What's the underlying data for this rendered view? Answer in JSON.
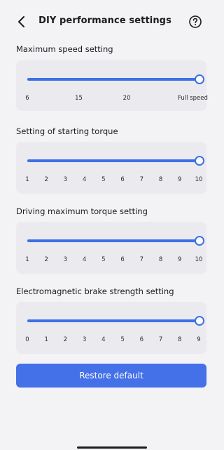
{
  "header": {
    "title": "DIY performance settings",
    "back_icon": "chevron-left-icon",
    "help_icon": "question-circle-icon"
  },
  "settings": [
    {
      "id": "max-speed",
      "label": "Maximum speed setting",
      "ticks": [
        "6",
        "15",
        "20",
        "Full speed"
      ],
      "value": "Full speed",
      "fraction": 1.0
    },
    {
      "id": "starting-torque",
      "label": "Setting of starting torque",
      "ticks": [
        "1",
        "2",
        "3",
        "4",
        "5",
        "6",
        "7",
        "8",
        "9",
        "10"
      ],
      "value": "10",
      "fraction": 1.0
    },
    {
      "id": "max-torque",
      "label": "Driving maximum torque setting",
      "ticks": [
        "1",
        "2",
        "3",
        "4",
        "5",
        "6",
        "7",
        "8",
        "9",
        "10"
      ],
      "value": "10",
      "fraction": 1.0
    },
    {
      "id": "brake-strength",
      "label": "Electromagnetic brake strength setting",
      "ticks": [
        "0",
        "1",
        "2",
        "3",
        "4",
        "5",
        "6",
        "7",
        "8",
        "9"
      ],
      "value": "9",
      "fraction": 1.0
    }
  ],
  "restore_button": {
    "label": "Restore default"
  },
  "colors": {
    "accent": "#3f6fe6",
    "button": "#4470e8",
    "card": "#ebebef",
    "background": "#f3f3f6"
  }
}
